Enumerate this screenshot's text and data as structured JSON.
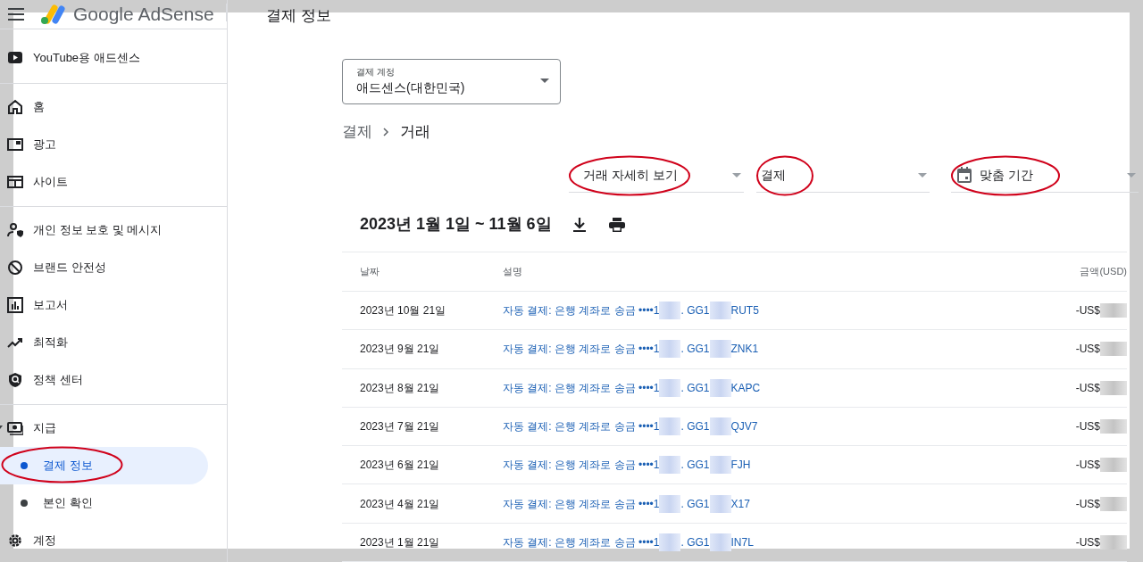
{
  "header": {
    "product": "Google AdSense",
    "page_title": "결제 정보"
  },
  "sidebar": {
    "sections": [
      {
        "items": [
          {
            "label": "YouTube용 애드센스"
          }
        ]
      },
      {
        "items": [
          {
            "label": "홈"
          },
          {
            "label": "광고"
          },
          {
            "label": "사이트"
          }
        ]
      },
      {
        "items": [
          {
            "label": "개인 정보 보호 및 메시지"
          },
          {
            "label": "브랜드 안전성"
          },
          {
            "label": "보고서"
          },
          {
            "label": "최적화"
          },
          {
            "label": "정책 센터"
          }
        ]
      },
      {
        "items": [
          {
            "label": "지급",
            "expanded": true,
            "children": [
              {
                "label": "결제 정보",
                "selected": true,
                "highlighted": true
              },
              {
                "label": "본인 확인",
                "selected": false,
                "highlighted": false
              }
            ]
          },
          {
            "label": "계정"
          }
        ]
      }
    ]
  },
  "payment_account": {
    "label": "결제 계정",
    "value": "애드센스(대한민국)"
  },
  "breadcrumb": [
    "결제",
    "거래"
  ],
  "filters": [
    {
      "kind": "select",
      "value": "거래 자세히 보기",
      "highlighted": true
    },
    {
      "kind": "select",
      "value": "결제",
      "highlighted": true
    },
    {
      "kind": "date",
      "value": "맞춤 기간",
      "highlighted": true
    }
  ],
  "date_range": "2023년 1월 1일 ~ 11월 6일",
  "table": {
    "columns": [
      "날짜",
      "설명",
      "금액(USD)"
    ],
    "rows": [
      {
        "date": "2023년 10월 21일",
        "description": [
          "자동 결제: 은행 계좌로 송금 ••••1",
          ". GG1",
          "RUT5"
        ],
        "amount": "-US$"
      },
      {
        "date": "2023년 9월 21일",
        "description": [
          "자동 결제: 은행 계좌로 송금 ••••1",
          ". GG1",
          "ZNK1"
        ],
        "amount": "-US$"
      },
      {
        "date": "2023년 8월 21일",
        "description": [
          "자동 결제: 은행 계좌로 송금 ••••1",
          ". GG1",
          "KAPC"
        ],
        "amount": "-US$"
      },
      {
        "date": "2023년 7월 21일",
        "description": [
          "자동 결제: 은행 계좌로 송금 ••••1",
          ". GG1",
          "QJV7"
        ],
        "amount": "-US$"
      },
      {
        "date": "2023년 6월 21일",
        "description": [
          "자동 결제: 은행 계좌로 송금 ••••1",
          ". GG1",
          "FJH"
        ],
        "amount": "-US$"
      },
      {
        "date": "2023년 4월 21일",
        "description": [
          "자동 결제: 은행 계좌로 송금 ••••1",
          ". GG1",
          "X17"
        ],
        "amount": "-US$"
      },
      {
        "date": "2023년 1월 21일",
        "description": [
          "자동 결제: 은행 계좌로 송금 ••••1",
          ". GG1",
          "IN7L"
        ],
        "amount": "-US$"
      }
    ]
  }
}
